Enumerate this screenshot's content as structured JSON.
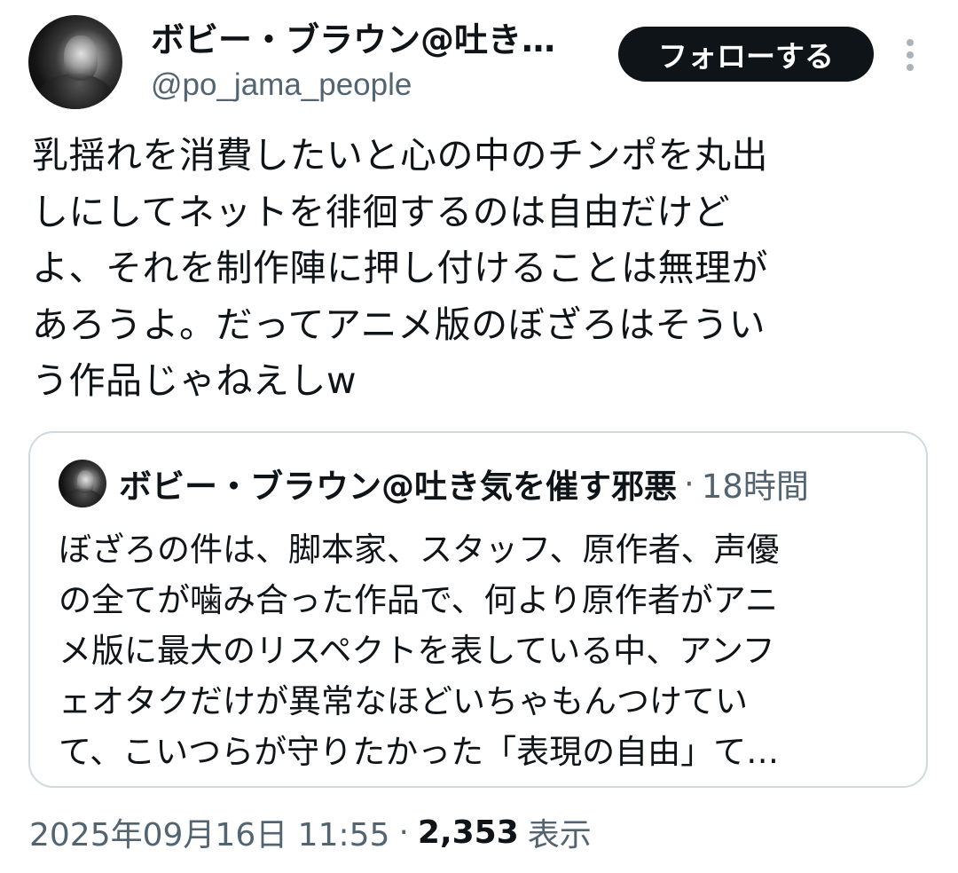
{
  "author": {
    "display_name": "ボビー・ブラウン@吐き…",
    "handle": "@po_jama_people"
  },
  "follow_button": {
    "label": "フォローする"
  },
  "more_icon": "more-vertical-icon",
  "tweet": {
    "text_lines": [
      "乳揺れを消費したいと心の中のチンポを丸出",
      "しにしてネットを徘徊するのは自由だけど",
      "よ、それを制作陣に押し付けることは無理が",
      "あろうよ。だってアニメ版のぼざろはそうい",
      "う作品じゃねえしw"
    ]
  },
  "quoted_tweet": {
    "display_name": "ボビー・ブラウン@吐き気を催す邪悪",
    "separator": "·",
    "time": "18時間",
    "text_lines": [
      "ぼざろの件は、脚本家、スタッフ、原作者、声優",
      "の全てが噛み合った作品で、何より原作者がアニ",
      "メ版に最大のリスペクトを表している中、アンフ",
      "ェオタクだけが異常なほどいちゃもんつけてい",
      "て、こいつらが守りたかった「表現の自由」て…"
    ]
  },
  "meta": {
    "timestamp": "2025年09月16日 11:55",
    "separator": "·",
    "view_count": "2,353",
    "views_label": "表示"
  },
  "colors": {
    "text_primary": "#0f1419",
    "text_secondary": "#536471",
    "border": "#cfd9de",
    "follow_bg": "#0f1419",
    "follow_text": "#ffffff"
  }
}
